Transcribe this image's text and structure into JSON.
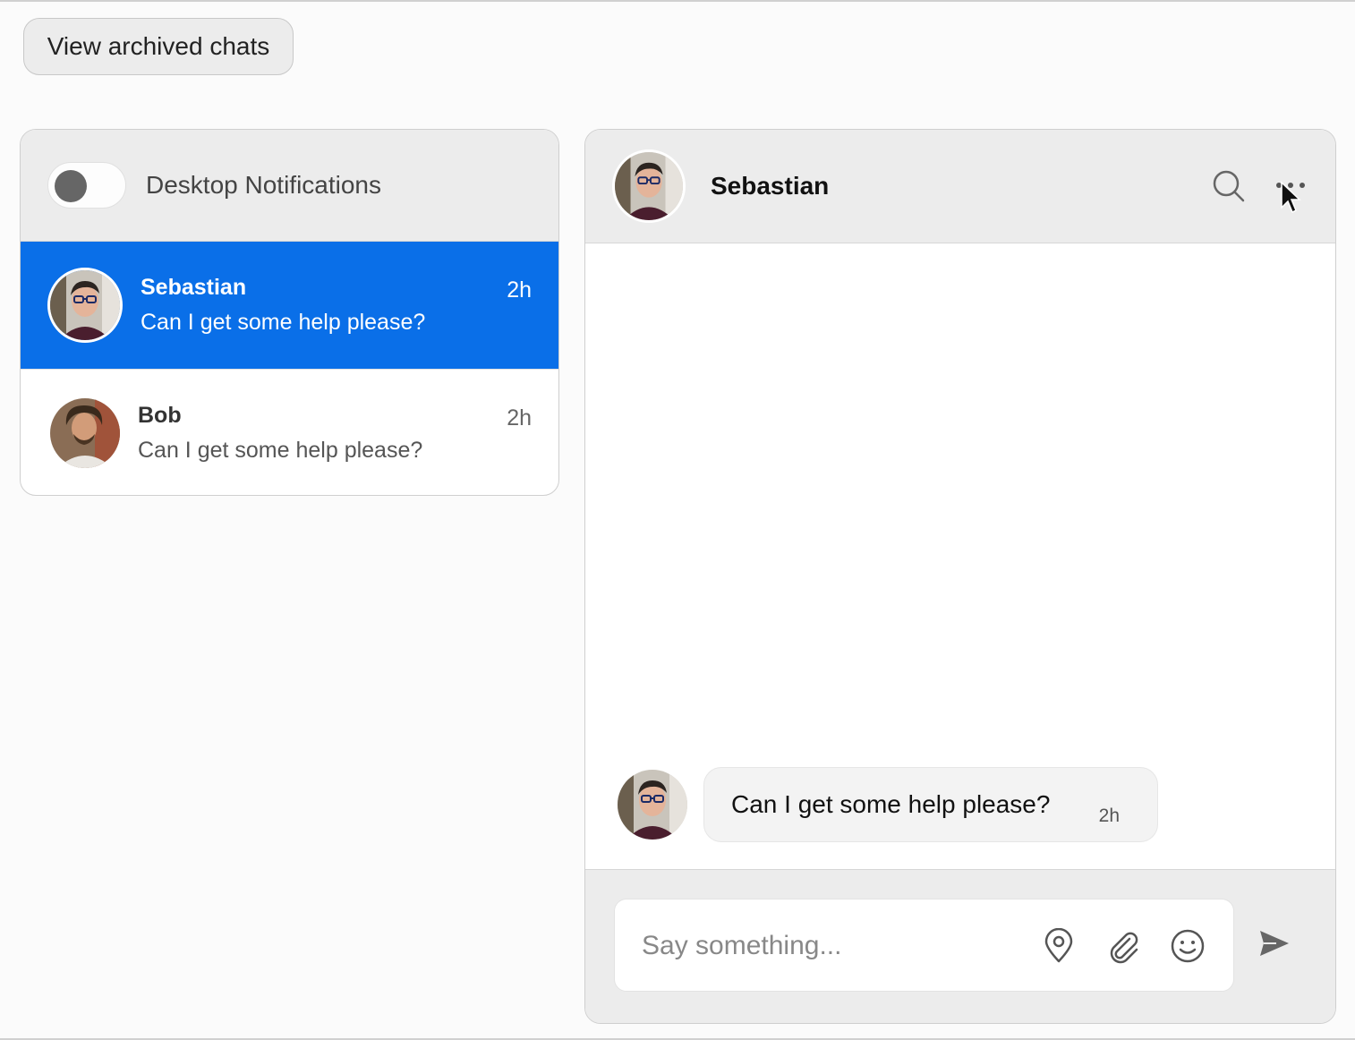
{
  "toolbar": {
    "archived_label": "View archived chats"
  },
  "sidebar": {
    "notifications_label": "Desktop Notifications",
    "notifications_enabled": false,
    "chats": [
      {
        "name": "Sebastian",
        "preview": "Can I get some help please?",
        "time": "2h",
        "active": true
      },
      {
        "name": "Bob",
        "preview": "Can I get some help please?",
        "time": "2h",
        "active": false
      }
    ]
  },
  "conversation": {
    "title": "Sebastian",
    "header_icons": [
      "search-icon",
      "more-icon"
    ],
    "messages": [
      {
        "text": "Can I get some help please?",
        "time": "2h"
      }
    ],
    "composer": {
      "placeholder": "Say something...",
      "icons": [
        "location-pin-icon",
        "paperclip-icon",
        "smiley-icon",
        "send-icon"
      ]
    }
  },
  "colors": {
    "accent": "#0a6fe8",
    "panel_header": "#ececec",
    "background": "#fbfbfb"
  }
}
